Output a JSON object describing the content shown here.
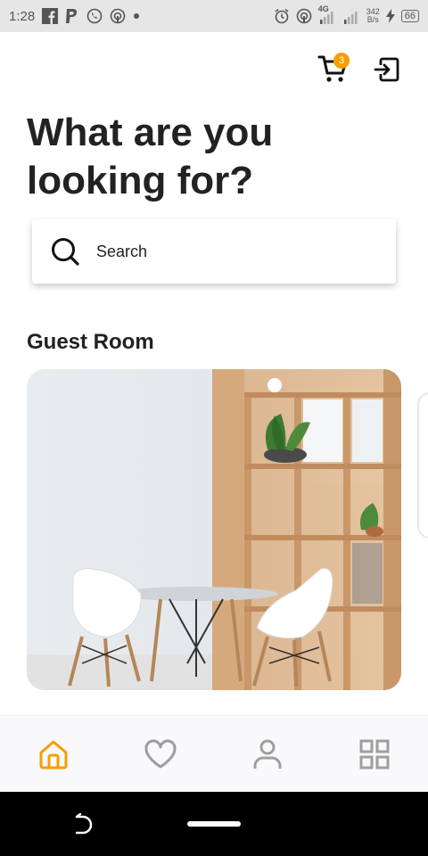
{
  "status_bar": {
    "time": "1:28",
    "network_speed_value": "342",
    "network_speed_unit": "B/s",
    "battery": "66",
    "signal_label": "4G"
  },
  "header": {
    "cart_count": "3",
    "icons": [
      "shopping-cart-icon",
      "logout-icon"
    ]
  },
  "heading": {
    "line1": "What are you",
    "line2": "looking for?"
  },
  "search": {
    "placeholder": "Search"
  },
  "section": {
    "title": "Guest Room"
  },
  "bottom_nav": {
    "items": [
      {
        "name": "home",
        "icon": "home-icon",
        "active": true
      },
      {
        "name": "favorites",
        "icon": "heart-icon",
        "active": false
      },
      {
        "name": "profile",
        "icon": "user-icon",
        "active": false
      },
      {
        "name": "menu",
        "icon": "grid-icon",
        "active": false
      }
    ]
  },
  "colors": {
    "accent": "#f5a000",
    "inactive_icon": "#9e9e9e",
    "text": "#222222"
  }
}
